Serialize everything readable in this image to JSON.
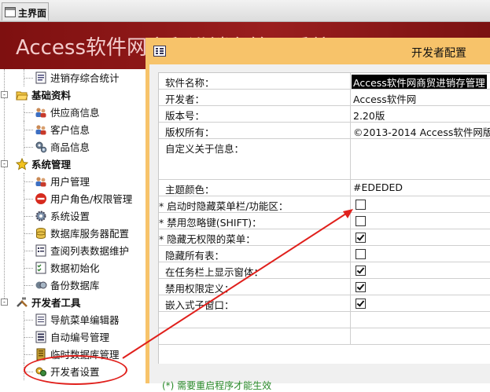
{
  "tab": {
    "label": "主界面"
  },
  "banner": {
    "title": "Access软件网商贸进销存管理系统"
  },
  "nav": {
    "items": [
      {
        "label": "进销存综合统计",
        "icon": "report-icon",
        "level": "child"
      },
      {
        "label": "基础资料",
        "icon": "folder-open-icon",
        "level": "group"
      },
      {
        "label": "供应商信息",
        "icon": "users-icon",
        "level": "child"
      },
      {
        "label": "客户信息",
        "icon": "users-icon",
        "level": "child"
      },
      {
        "label": "商品信息",
        "icon": "gears-icon",
        "level": "child"
      },
      {
        "label": "系统管理",
        "icon": "star-icon",
        "level": "group"
      },
      {
        "label": "用户管理",
        "icon": "users-icon",
        "level": "child"
      },
      {
        "label": "用户角色/权限管理",
        "icon": "no-entry-icon",
        "level": "child"
      },
      {
        "label": "系统设置",
        "icon": "gear-icon",
        "level": "child"
      },
      {
        "label": "数据库服务器配置",
        "icon": "database-icon",
        "level": "child"
      },
      {
        "label": "查阅列表数据维护",
        "icon": "list-icon",
        "level": "child"
      },
      {
        "label": "数据初始化",
        "icon": "check-list-icon",
        "level": "child"
      },
      {
        "label": "备份数据库",
        "icon": "backup-icon",
        "level": "child"
      },
      {
        "label": "开发者工具",
        "icon": "tools-icon",
        "level": "group"
      },
      {
        "label": "导航菜单编辑器",
        "icon": "document-icon",
        "level": "child"
      },
      {
        "label": "自动编号管理",
        "icon": "numbering-icon",
        "level": "child"
      },
      {
        "label": "临时数据库管理",
        "icon": "database-temp-icon",
        "level": "child"
      },
      {
        "label": "开发者设置",
        "icon": "developer-icon",
        "level": "child"
      }
    ]
  },
  "dialog": {
    "title": "开发者配置",
    "rows": [
      {
        "label": "软件名称：",
        "value": "Access软件网商贸进销存管理",
        "type": "text",
        "selected": true
      },
      {
        "label": "开发者：",
        "value": "Access软件网",
        "type": "text"
      },
      {
        "label": "版本号：",
        "value": "2.20版",
        "type": "text"
      },
      {
        "label": "版权所有：",
        "value": "©2013-2014 Access软件网版",
        "type": "text"
      },
      {
        "label": "自定义关于信息：",
        "value": "",
        "type": "multiline"
      },
      {
        "label": "主题颜色：",
        "value": "#EDEDED",
        "type": "text"
      },
      {
        "label": "* 启动时隐藏菜单栏/功能区：",
        "checked": false,
        "type": "checkbox"
      },
      {
        "label": "* 禁用忽略键(SHIFT)：",
        "checked": false,
        "type": "checkbox"
      },
      {
        "label": "* 隐藏无权限的菜单：",
        "checked": true,
        "type": "checkbox"
      },
      {
        "label": "隐藏所有表：",
        "checked": false,
        "type": "checkbox"
      },
      {
        "label": "在任务栏上显示窗体：",
        "checked": true,
        "type": "checkbox"
      },
      {
        "label": "禁用权限定义：",
        "checked": true,
        "type": "checkbox"
      },
      {
        "label": "嵌入式子窗口：",
        "checked": true,
        "type": "checkbox"
      },
      {
        "label": "",
        "value": "",
        "type": "blank"
      },
      {
        "label": "",
        "value": "",
        "type": "blank"
      }
    ],
    "footnote": "(*) 需要重启程序才能生效"
  },
  "colors": {
    "banner": "#8b1414",
    "dialog_frame": "#f7c36a",
    "annotation": "#e0201c",
    "footnote": "#2a8a2a"
  }
}
